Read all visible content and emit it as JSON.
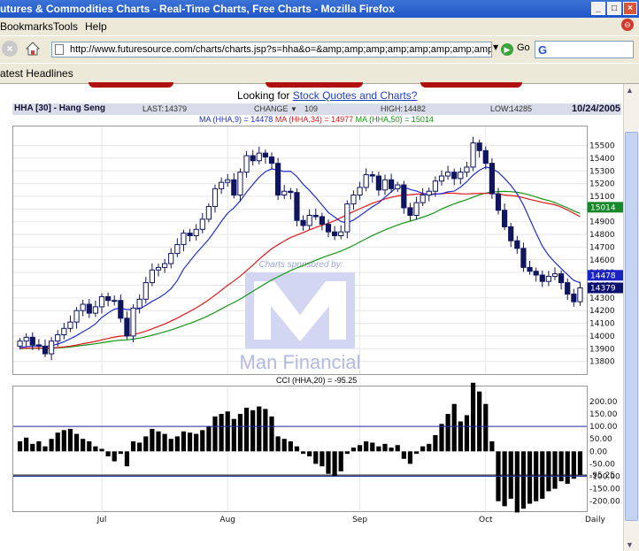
{
  "window": {
    "title": "utures & Commodities Charts - Real-Time Charts, Free Charts - Mozilla Firefox",
    "btn_min": "_",
    "btn_max": "□",
    "btn_close": "×"
  },
  "menu": {
    "bookmarks": "Bookmarks",
    "tools": "Tools",
    "help": "Help"
  },
  "nav": {
    "url": "http://www.futuresource.com/charts/charts.jsp?s=hha&o=&amp;amp;amp;amp;amp;amp;amp;amp;a=D",
    "go_label": "Go",
    "search_logo": "G"
  },
  "bookmarks_bar": {
    "item": "atest Headlines"
  },
  "page": {
    "looking_prefix": "Looking for ",
    "looking_link": "Stock Quotes and Charts?",
    "symbol": "HHA [30] - Hang Seng",
    "last_label": "LAST:",
    "last_value": "14379",
    "change_label": "CHANGE",
    "change_value": "109",
    "high_label": "HIGH:",
    "high_value": "14482",
    "low_label": "LOW:",
    "low_value": "14285",
    "date": "10/24/2005",
    "ma9": "MA (HHA,9) = 14478",
    "ma34": "MA (HHA,34) = 14977",
    "ma50": "MA (HHA,50) = 15014",
    "sponsor_text": "Charts sponsored by:",
    "sponsor_name": "Man Financial",
    "cci_title": "CCI (HHA,20) = -95.25"
  },
  "colors": {
    "candle": "#101560",
    "ma9": "#1f2fd6",
    "ma34": "#e01818",
    "ma50": "#139613",
    "cci": "#000000",
    "label_green": "#17882a",
    "label_blue": "#1a23c6",
    "label_dark": "#0b0f70"
  },
  "chart_data": [
    {
      "type": "candlestick",
      "title": "HHA [30] - Hang Seng",
      "ylim": [
        13700,
        15650
      ],
      "y_ticks": [
        13800,
        13900,
        14000,
        14100,
        14200,
        14300,
        14400,
        14500,
        14600,
        14700,
        14800,
        14900,
        15000,
        15100,
        15200,
        15300,
        15400,
        15500
      ],
      "x_labels": [
        {
          "label": "Jul",
          "index": 13
        },
        {
          "label": "Aug",
          "index": 33
        },
        {
          "label": "Sep",
          "index": 54
        },
        {
          "label": "Oct",
          "index": 74
        },
        {
          "label": "Daily",
          "index": 90
        }
      ],
      "last_labels": [
        {
          "value": "15014",
          "text": "15014",
          "color": "label_green"
        },
        {
          "value": "14478",
          "text": "14478",
          "color": "label_blue"
        },
        {
          "value": "14379",
          "text": "14379",
          "color": "label_dark"
        }
      ],
      "close": [
        13960,
        13990,
        13930,
        13920,
        13860,
        13960,
        14010,
        14060,
        14110,
        14200,
        14250,
        14180,
        14230,
        14310,
        14280,
        14280,
        14140,
        14000,
        14220,
        14290,
        14420,
        14520,
        14540,
        14570,
        14650,
        14720,
        14810,
        14790,
        14840,
        14920,
        15020,
        15160,
        15210,
        15230,
        15110,
        15290,
        15420,
        15380,
        15440,
        15410,
        15360,
        15110,
        15140,
        15130,
        14910,
        14870,
        14950,
        14940,
        14880,
        14820,
        14790,
        14820,
        15040,
        15110,
        15170,
        15270,
        15260,
        15150,
        15230,
        15160,
        15190,
        15010,
        14950,
        15050,
        15110,
        15140,
        15220,
        15260,
        15290,
        15240,
        15290,
        15330,
        15520,
        15460,
        15360,
        15120,
        14990,
        14860,
        14750,
        14690,
        14540,
        14510,
        14480,
        14430,
        14470,
        14490,
        14420,
        14330,
        14270,
        14379
      ],
      "cci": [
        40,
        55,
        30,
        40,
        20,
        50,
        75,
        85,
        90,
        70,
        50,
        40,
        20,
        10,
        -20,
        -40,
        -10,
        -60,
        40,
        35,
        60,
        90,
        80,
        70,
        50,
        60,
        80,
        75,
        70,
        85,
        100,
        140,
        150,
        160,
        130,
        150,
        175,
        165,
        180,
        170,
        140,
        60,
        50,
        40,
        20,
        -10,
        -20,
        -50,
        -60,
        -90,
        -100,
        -80,
        -10,
        15,
        25,
        40,
        35,
        20,
        30,
        15,
        25,
        -30,
        -50,
        -10,
        20,
        30,
        65,
        110,
        150,
        190,
        120,
        145,
        275,
        240,
        190,
        40,
        -200,
        -220,
        -190,
        -245,
        -230,
        -210,
        -200,
        -190,
        -160,
        -150,
        -120,
        -130,
        -110,
        -95.25
      ],
      "cci_ylim": [
        -240,
        260
      ],
      "cci_ticks": [
        200,
        150,
        100,
        50,
        0,
        -50,
        -100,
        -150,
        -200
      ],
      "cci_last": -95.25
    }
  ]
}
